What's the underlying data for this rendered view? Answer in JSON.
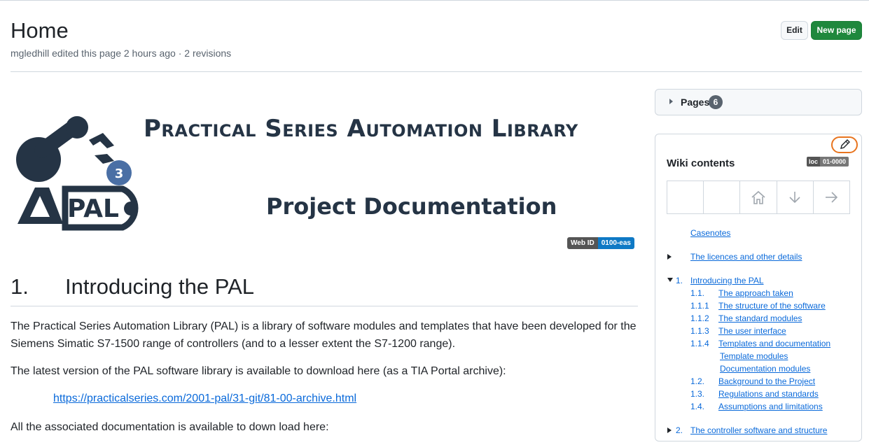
{
  "header": {
    "title": "Home",
    "meta": "mgledhill edited this page 2 hours ago · 2 revisions",
    "edit_label": "Edit",
    "new_page_label": "New page"
  },
  "banner": {
    "title": "Practical Series Automation Library",
    "subtitle": "Project Documentation",
    "logo_text": "PAL",
    "logo_badge": "3",
    "web_id_key": "Web ID",
    "web_id_value": "0100-eas"
  },
  "content": {
    "heading_num": "1.",
    "heading_text": "Introducing the PAL",
    "para1": "The Practical Series Automation Library (PAL) is a library of software modules and templates that have been developed for the Siemens Simatic S7-1500 range of controllers (and to a lesser extent the S7-1200 range).",
    "para2": "The latest version of the PAL software library is available to download here (as a TIA Portal archive):",
    "link": "https://practicalseries.com/2001-pal/31-git/81-00-archive.html",
    "para3": "All the associated documentation is available to down load here:"
  },
  "sidebar": {
    "pages_label": "Pages",
    "pages_count": "6",
    "wiki_title": "Wiki contents",
    "loc_key": "loc",
    "loc_value": "01-0000",
    "nav_icons": [
      "",
      "",
      "home-icon",
      "arrow-down-icon",
      "arrow-right-icon"
    ],
    "toc": [
      {
        "num": "",
        "label": "Casenotes"
      },
      {
        "num": "",
        "label": "The licences and other details"
      },
      {
        "num": "1.",
        "label": "Introducing the PAL"
      },
      {
        "num": "1.1.",
        "label": "The approach taken"
      },
      {
        "num": "1.1.1",
        "label": "The structure of the software"
      },
      {
        "num": "1.1.2",
        "label": "The standard modules"
      },
      {
        "num": "1.1.3",
        "label": "The user interface"
      },
      {
        "num": "1.1.4",
        "label": "Templates and documentation"
      },
      {
        "num": "",
        "label": "Template modules"
      },
      {
        "num": "",
        "label": "Documentation modules"
      },
      {
        "num": "1.2.",
        "label": "Background to the Project"
      },
      {
        "num": "1.3.",
        "label": "Regulations and standards"
      },
      {
        "num": "1.4.",
        "label": "Assumptions and limitations"
      },
      {
        "num": "2.",
        "label": "The controller software and structure"
      }
    ]
  },
  "colors": {
    "accent_green": "#1f883d",
    "link_blue": "#0969da",
    "logo_navy": "#253445",
    "logo_badge_blue": "#4a6fa5",
    "highlight_orange": "#e8741e"
  }
}
